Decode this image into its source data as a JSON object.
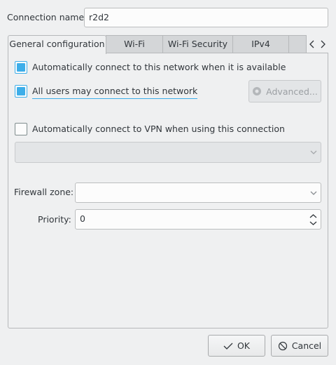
{
  "connection": {
    "name_label": "Connection name:",
    "name_value": "r2d2"
  },
  "tabs": [
    {
      "label": "General configuration",
      "active": true
    },
    {
      "label": "Wi-Fi",
      "active": false
    },
    {
      "label": "Wi-Fi Security",
      "active": false
    },
    {
      "label": "IPv4",
      "active": false
    }
  ],
  "general": {
    "auto_connect_label": "Automatically connect to this network when it is available",
    "auto_connect_checked": true,
    "all_users_label": "All users may connect to this network",
    "all_users_checked": true,
    "advanced_label": "Advanced...",
    "vpn_label": "Automatically connect to VPN when using this connection",
    "vpn_checked": false,
    "vpn_select_value": "",
    "firewall_label": "Firewall zone:",
    "firewall_value": "",
    "priority_label": "Priority:",
    "priority_value": "0"
  },
  "buttons": {
    "ok_label": "OK",
    "cancel_label": "Cancel"
  },
  "colors": {
    "accent": "#3daee9",
    "window_bg": "#eff0f1"
  }
}
